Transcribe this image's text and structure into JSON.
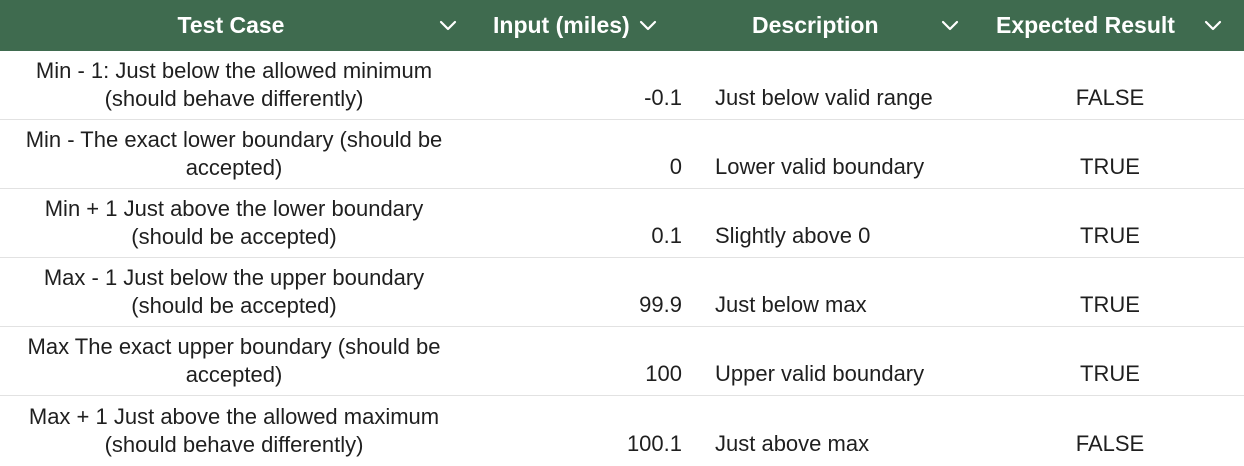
{
  "table": {
    "columns": [
      {
        "label": "Test Case",
        "icon": "chevron-down-icon"
      },
      {
        "label": "Input (miles)",
        "icon": "chevron-down-icon"
      },
      {
        "label": "Description",
        "icon": "chevron-down-icon"
      },
      {
        "label": "Expected Result",
        "icon": "chevron-down-icon"
      }
    ],
    "rows": [
      {
        "test_case": "Min - 1: Just below the allowed minimum (should behave differently)",
        "input": "-0.1",
        "description": "Just below valid range",
        "expected": "FALSE"
      },
      {
        "test_case": "Min  - The exact lower boundary (should be accepted)",
        "input": "0",
        "description": "Lower valid boundary",
        "expected": "TRUE"
      },
      {
        "test_case": "Min + 1  Just above the lower boundary (should be accepted)",
        "input": "0.1",
        "description": "Slightly above 0",
        "expected": "TRUE"
      },
      {
        "test_case": "Max - 1 Just below the upper boundary (should be accepted)",
        "input": "99.9",
        "description": "Just below max",
        "expected": "TRUE"
      },
      {
        "test_case": "Max The exact upper boundary (should be accepted)",
        "input": "100",
        "description": "Upper valid boundary",
        "expected": "TRUE"
      },
      {
        "test_case": "Max + 1 Just above the allowed maximum (should behave differently)",
        "input": "100.1",
        "description": "Just above max",
        "expected": "FALSE"
      }
    ]
  },
  "colors": {
    "header_bg": "#3f6b4f",
    "header_text": "#ffffff",
    "row_divider": "#e2e2e2"
  }
}
